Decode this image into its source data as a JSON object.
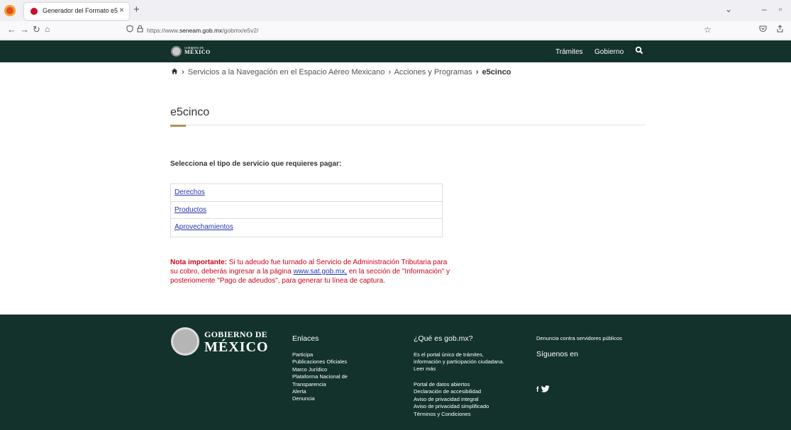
{
  "browser": {
    "tab_title": "Generador del Formato e5",
    "tab_close": "×",
    "new_tab": "+",
    "url_prefix": "https://www.",
    "url_domain": "seneam.gob.mx",
    "url_path": "/gobmx/e5v2/",
    "controls": {
      "list": "⌄",
      "minimize": "–",
      "maximize": "▫"
    }
  },
  "header": {
    "logo_small": "GOBIERNO DE",
    "logo_big": "MÉXICO",
    "links": [
      "Trámites",
      "Gobierno"
    ]
  },
  "breadcrumb": {
    "items": [
      "Servicios a la Navegación en el Espacio Aéreo Mexicano",
      "Acciones y Programas"
    ],
    "current": "e5cinco",
    "sep": "›"
  },
  "page": {
    "title": "e5cinco",
    "prompt": "Selecciona el tipo de servicio que requieres pagar:",
    "services": [
      "Derechos",
      "Productos",
      "Aprovechamientos"
    ],
    "note": {
      "label": "Nota importante:",
      "text1": " Si tu adeudo fue turnado al Servicio de Administración Tributaria para su cobro, deberás ingresar a la página ",
      "link": "www.sat.gob.mx,",
      "text2": " en la sección de \"Información\" y posteriomente \"Pago de adeudos\", para generar tu línea de captura."
    }
  },
  "footer": {
    "brand_small": "GOBIERNO DE",
    "brand_big": "MÉXICO",
    "enlaces": {
      "title": "Enlaces",
      "items": [
        "Participa",
        "Publicaciones Oficiales",
        "Marco Jurídico",
        "Plataforma Nacional de",
        "Transparencia",
        "Alerta",
        "Denuncia"
      ]
    },
    "que_es": {
      "title": "¿Qué es gob.mx?",
      "text": "Es el portal único de trámites, información y participación ciudadana. Leer más",
      "items": [
        "Portal de datos abiertos",
        "Declaración de accesibilidad",
        "Aviso de privacidad integral",
        "Aviso de privacidad simplificado",
        "Términos y Condiciones"
      ]
    },
    "denuncia": "Denuncia contra servidores públicos",
    "siguenos": "Síguenos en",
    "social_f": "f"
  },
  "colors": {
    "header_bg": "#13322b",
    "accent_gold": "#b38e5d",
    "link": "#2437b5",
    "note_red": "#d0021b"
  }
}
